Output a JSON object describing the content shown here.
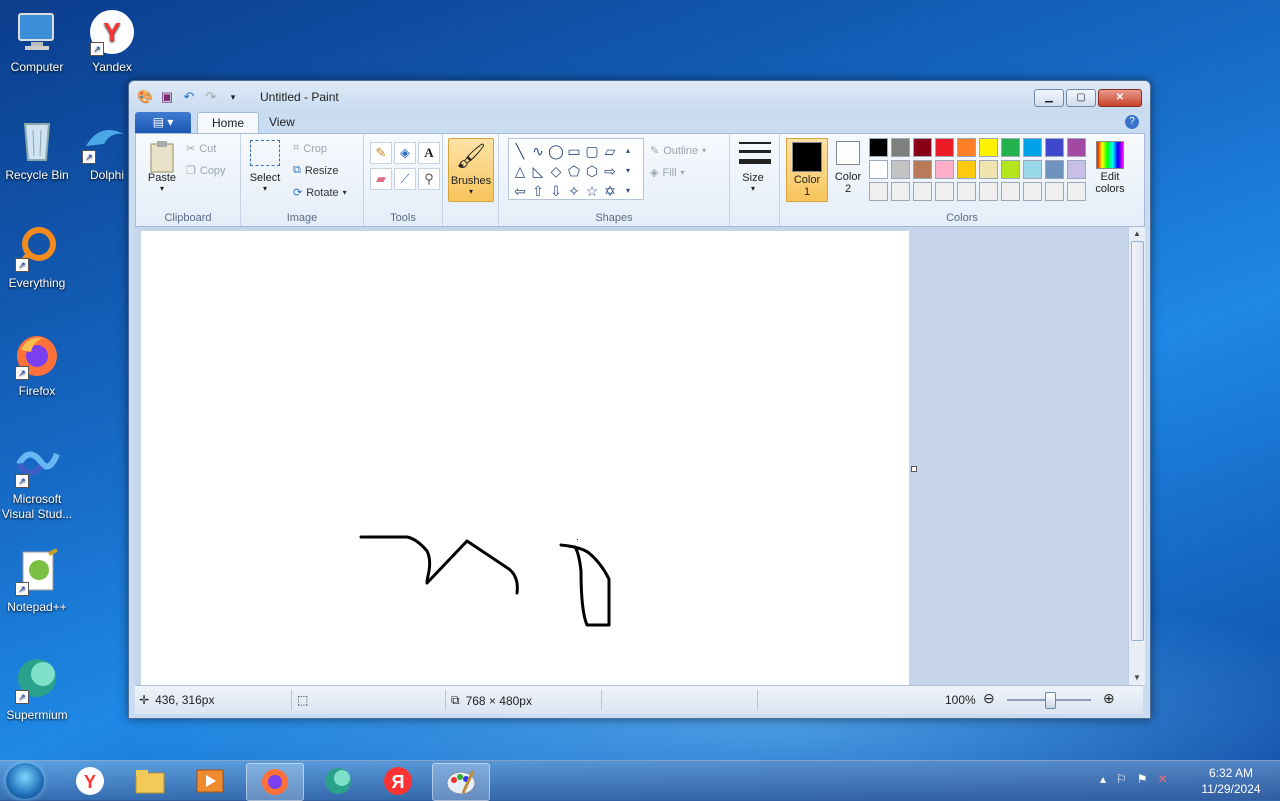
{
  "desktop": {
    "icons": [
      {
        "label": "Computer"
      },
      {
        "label": "Yandex"
      },
      {
        "label": "Recycle Bin"
      },
      {
        "label": "Dolphi"
      },
      {
        "label": "Everything"
      },
      {
        "label": "Firefox"
      },
      {
        "label": "Microsoft Visual Stud..."
      },
      {
        "label": "Notepad++"
      },
      {
        "label": "Supermium"
      }
    ]
  },
  "window": {
    "title": "Untitled - Paint",
    "tabs": {
      "file": "▤ ▾",
      "home": "Home",
      "view": "View"
    },
    "help": "?"
  },
  "ribbon": {
    "clipboard": {
      "label": "Clipboard",
      "paste": "Paste",
      "cut": "Cut",
      "copy": "Copy"
    },
    "image": {
      "label": "Image",
      "select": "Select",
      "crop": "Crop",
      "resize": "Resize",
      "rotate": "Rotate"
    },
    "tools": {
      "label": "Tools"
    },
    "brushes": "Brushes",
    "shapes": {
      "label": "Shapes",
      "outline": "Outline",
      "fill": "Fill"
    },
    "size": "Size",
    "colors": {
      "label": "Colors",
      "color1": "Color",
      "color1_num": "1",
      "color2": "Color",
      "color2_num": "2",
      "edit": "Edit",
      "edit2": "colors",
      "color1_value": "#000000",
      "color2_value": "#ffffff",
      "palette": [
        "#000000",
        "#7f7f7f",
        "#880015",
        "#ed1c24",
        "#ff7f27",
        "#fff200",
        "#22b14c",
        "#00a2e8",
        "#3f48cc",
        "#a349a4",
        "#ffffff",
        "#c3c3c3",
        "#b97a57",
        "#ffaec9",
        "#ffc90e",
        "#efe4b0",
        "#b5e61d",
        "#99d9ea",
        "#7092be",
        "#c8bfe7",
        "#f0f0f0",
        "#f0f0f0",
        "#f0f0f0",
        "#f0f0f0",
        "#f0f0f0",
        "#f0f0f0",
        "#f0f0f0",
        "#f0f0f0",
        "#f0f0f0",
        "#f0f0f0"
      ]
    }
  },
  "status": {
    "cursor_pos": "436, 316px",
    "image_size": "768 × 480px",
    "zoom": "100%"
  },
  "taskbar": {
    "time": "6:32 AM",
    "date": "11/29/2024"
  }
}
